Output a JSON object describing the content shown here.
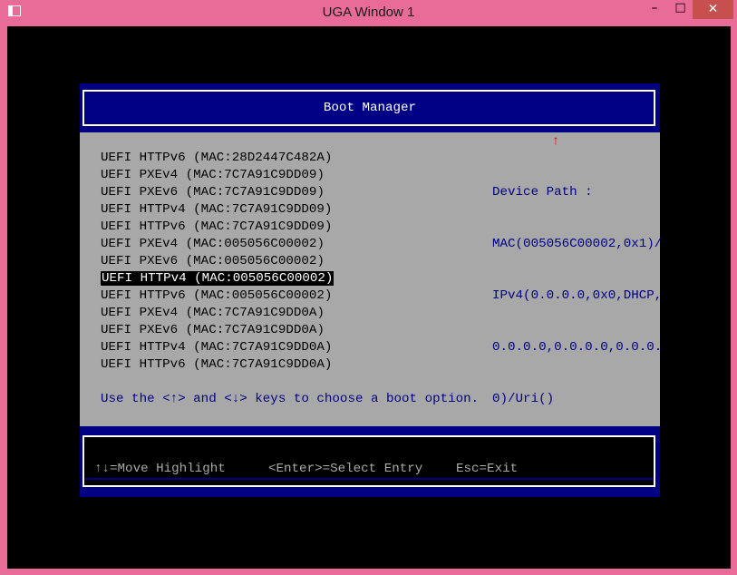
{
  "window": {
    "title": "UGA Window 1",
    "controls": {
      "minimize": "–",
      "maximize": "□",
      "close": "✕"
    }
  },
  "boot_manager": {
    "title": "Boot Manager",
    "scroll_indicator": "↑",
    "entries": [
      "UEFI HTTPv6 (MAC:28D2447C482A)",
      "UEFI PXEv4 (MAC:7C7A91C9DD09)",
      "UEFI PXEv6 (MAC:7C7A91C9DD09)",
      "UEFI HTTPv4 (MAC:7C7A91C9DD09)",
      "UEFI HTTPv6 (MAC:7C7A91C9DD09)",
      "UEFI PXEv4 (MAC:005056C00002)",
      "UEFI PXEv6 (MAC:005056C00002)",
      "UEFI HTTPv4 (MAC:005056C00002)",
      "UEFI HTTPv6 (MAC:005056C00002)",
      "UEFI PXEv4 (MAC:7C7A91C9DD0A)",
      "UEFI PXEv6 (MAC:7C7A91C9DD0A)",
      "UEFI HTTPv4 (MAC:7C7A91C9DD0A)",
      "UEFI HTTPv6 (MAC:7C7A91C9DD0A)"
    ],
    "selected_index": 7,
    "device_path": {
      "label": "Device Path :",
      "lines": [
        "MAC(005056C00002,0x1)/",
        "IPv4(0.0.0.0,0x0,DHCP,",
        "0.0.0.0,0.0.0.0,0.0.0.",
        "0)/Uri()"
      ]
    },
    "hint": "Use the <↑> and <↓> keys to choose a boot option."
  },
  "footer": {
    "move": "↑↓=Move Highlight",
    "select": "<Enter>=Select Entry",
    "exit": "Esc=Exit"
  },
  "colors": {
    "title_bar": "#e86b98",
    "screen_background": "#000000",
    "panel_blue": "#000084",
    "panel_gray": "#a8a8a8",
    "scroll_indicator": "#ee0000"
  }
}
